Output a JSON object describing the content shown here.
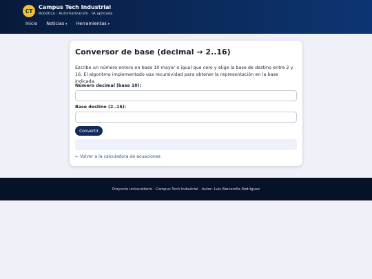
{
  "header": {
    "logo_text": "CT",
    "title": "Campus Tech Industrial",
    "tagline": "Robótica · Automatización · IA aplicada",
    "nav": [
      {
        "label": "Inicio",
        "has_caret": false
      },
      {
        "label": "Noticias",
        "has_caret": true
      },
      {
        "label": "Herramientas",
        "has_caret": true
      }
    ],
    "caret_icon": "▾"
  },
  "card": {
    "title": "Conversor de base (decimal → 2..16)",
    "description": "Escribe un número entero en base 10 mayor o igual que cero y elige la base de destino entre 2 y 16. El algoritmo implementado usa recursividad para obtener la representación en la base indicada.",
    "decimal_label": "Número decimal (base 10):",
    "decimal_value": "",
    "base_label": "Base destino (2..16):",
    "base_value": "",
    "convert_label": "Convertir",
    "result": "",
    "back_link": "← Volver a la calculadora de ecuaciones"
  },
  "footer": {
    "text": "Proyecto universitario · Campus Tech Industrial · Autor: Luis Barcenilla Rodríguez"
  },
  "colors": {
    "header_bg": "#0b2a5c",
    "logo_bg": "#f3c32b",
    "button_bg": "#0f2c5c",
    "link": "#1f4f9c",
    "footer_bg": "#071227",
    "page_bg": "#eff0f8"
  }
}
